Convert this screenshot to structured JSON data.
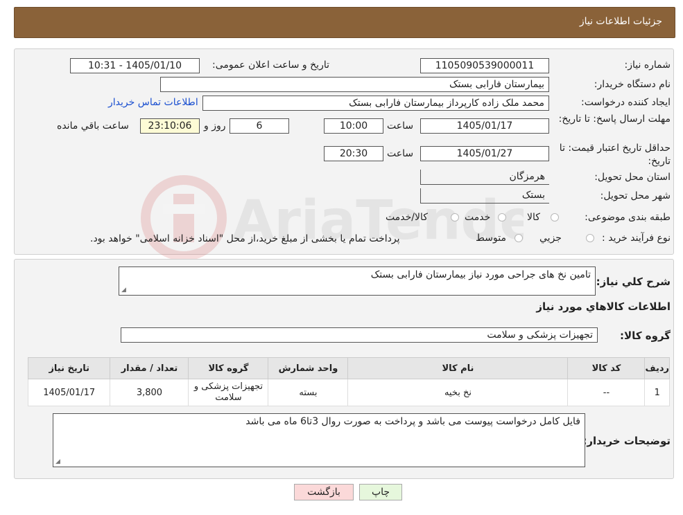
{
  "header": {
    "title": "جزئیات اطلاعات نیاز"
  },
  "form": {
    "need_number_label": "شماره نیاز:",
    "need_number": "1105090539000011",
    "announce_label": "تاریخ و ساعت اعلان عمومی:",
    "announce_value": "1405/01/10 - 10:31",
    "buyer_org_label": "نام دستگاه خریدار:",
    "buyer_org": "بیمارستان فارابی بستک",
    "creator_label": "ایجاد کننده درخواست:",
    "creator": "محمد ملک زاده کارپرداز بیمارستان فارابی بستک",
    "contact_link": "اطلاعات تماس خریدار",
    "deadline_label": "مهلت ارسال پاسخ: تا تاریخ:",
    "deadline_date": "1405/01/17",
    "time_label": "ساعت",
    "deadline_time": "10:00",
    "remaining_days": "6",
    "days_and_label": "روز و",
    "remaining_time": "23:10:06",
    "remaining_label": "ساعت باقي مانده",
    "validity_label": "حداقل تاریخ اعتبار قیمت: تا تاریخ:",
    "validity_date": "1405/01/27",
    "validity_time_label": "ساعت",
    "validity_time": "20:30",
    "province_label": "استان محل تحویل:",
    "province": "هرمزگان",
    "city_label": "شهر محل تحویل:",
    "city": "بستک",
    "category_label": "طبقه بندی موضوعی:",
    "category_options": [
      "کالا",
      "خدمت",
      "کالا/خدمت"
    ],
    "process_label": "نوع فرآیند خرید :",
    "process_options": [
      "جزیي",
      "متوسط"
    ],
    "process_note": "پرداخت تمام یا بخشی از مبلغ خرید،از محل \"اسناد خزانه اسلامی\" خواهد بود."
  },
  "details": {
    "summary_label": "شرح کلي نياز:",
    "summary": "تامین نخ های جراحی مورد نیاز بیمارستان فارابی بستک",
    "goods_info_title": "اطلاعات کالاهاي مورد نياز",
    "goods_group_label": "گروه کالا:",
    "goods_group": "تجهیزات پزشکی و سلامت"
  },
  "table": {
    "headers": [
      "رديف",
      "کد کالا",
      "نام کالا",
      "واحد شمارش",
      "گروه کالا",
      "تعداد / مقدار",
      "تاریخ نیاز"
    ],
    "rows": [
      [
        "1",
        "--",
        "نخ بخیه",
        "بسته",
        "تجهیزات پزشکی و سلامت",
        "3,800",
        "1405/01/17"
      ]
    ]
  },
  "buyer_notes": {
    "label": "توضیحات خریدار:",
    "text": "فایل کامل درخواست پیوست می باشد و پرداخت به صورت روال 3تا6 ماه می باشد"
  },
  "buttons": {
    "print": "چاپ",
    "back": "بازگشت"
  },
  "colors": {
    "header": "#8a6239",
    "link": "#1a4fd0",
    "back_btn": "#fbd9d9",
    "print_btn": "#e6f7dc"
  }
}
